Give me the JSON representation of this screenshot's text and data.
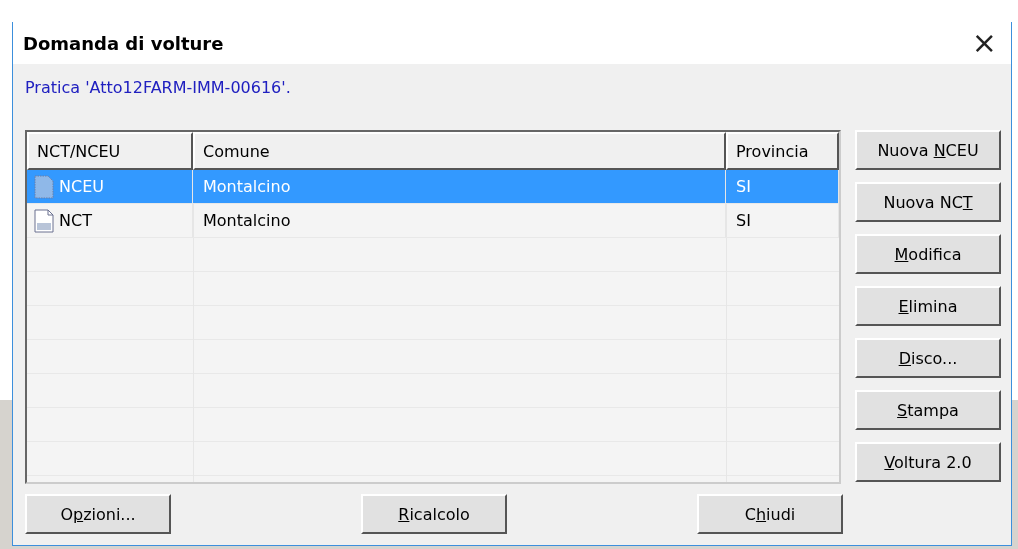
{
  "window": {
    "title": "Domanda di volture",
    "close": "×"
  },
  "subtitle": "Pratica 'Atto12FARM-IMM-00616'.",
  "table": {
    "columns": [
      "NCT/NCEU",
      "Comune",
      "Provincia"
    ],
    "rows": [
      {
        "kind": "nceu",
        "cells": [
          "NCEU",
          "Montalcino",
          "SI"
        ],
        "selected": true
      },
      {
        "kind": "nct",
        "cells": [
          "NCT",
          "Montalcino",
          "SI"
        ],
        "selected": false
      }
    ]
  },
  "side_buttons": [
    {
      "pre": "Nuova ",
      "key": "N",
      "post": "CEU"
    },
    {
      "pre": "Nuova NC",
      "key": "T"
    },
    {
      "key": "M",
      "post": "odifica"
    },
    {
      "key": "E",
      "post": "limina"
    },
    {
      "key": "D",
      "post": "isco..."
    },
    {
      "key": "S",
      "post": "tampa"
    },
    {
      "key": "V",
      "post": "oltura 2.0"
    }
  ],
  "bottom_buttons": [
    {
      "pre": "O",
      "key": "p",
      "post": "zioni..."
    },
    {
      "key": "R",
      "post": "icalcolo"
    },
    {
      "pre": "C",
      "key": "h",
      "post": "iudi"
    }
  ]
}
